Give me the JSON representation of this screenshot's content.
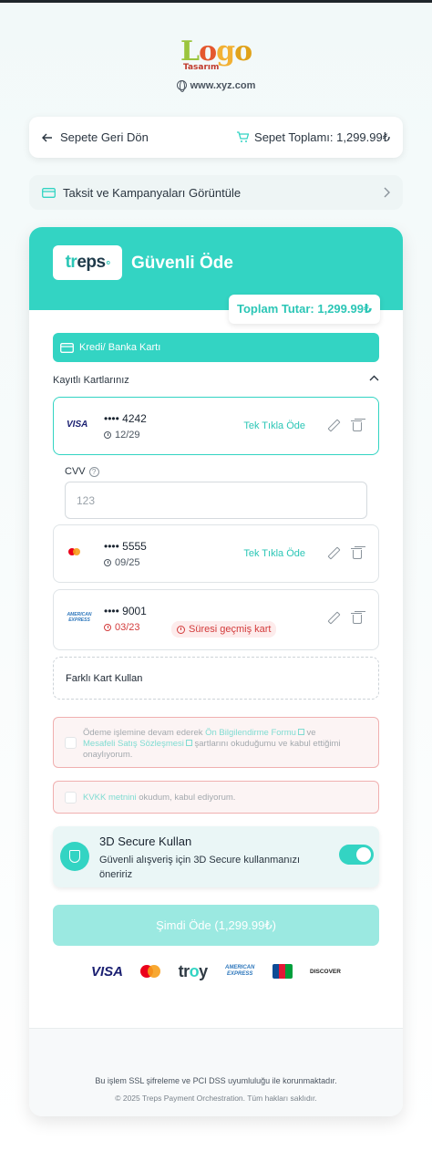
{
  "header": {
    "logo": "Logo Tasarım",
    "site_url": "www.xyz.com"
  },
  "nav": {
    "back_label": "Sepete Geri Dön",
    "cart_total_label": "Sepet Toplamı: 1,299.99₺",
    "installments_label": "Taksit ve Kampanyaları Görüntüle"
  },
  "payment": {
    "provider": "treps",
    "title": "Güvenli Öde",
    "total_label": "Toplam Tutar: 1,299.99₺",
    "method_label": "Kredi/ Banka Kartı",
    "saved_cards_heading": "Kayıtlı Kartlarınız",
    "cards": [
      {
        "brand": "VISA",
        "number": "•••• 4242",
        "expiry": "12/29",
        "action": "Tek Tıkla Öde",
        "selected": true,
        "expired": false
      },
      {
        "brand": "mastercard",
        "number": "•••• 5555",
        "expiry": "09/25",
        "action": "Tek Tıkla Öde",
        "selected": false,
        "expired": false
      },
      {
        "brand": "AMERICAN EXPRESS",
        "number": "•••• 9001",
        "expiry": "03/23",
        "expired_label": "Süresi geçmiş kart",
        "selected": false,
        "expired": true
      }
    ],
    "cvv_label": "CVV",
    "cvv_placeholder": "123",
    "other_card_label": "Farklı Kart Kullan",
    "consent1": {
      "pre": "Ödeme işlemine devam ederek ",
      "link1": "Ön Bilgilendirme Formu",
      "mid": " ve",
      "link2": "Mesafeli Satış Sözleşmesi",
      "post": " şartlarını okuduğumu ve kabul ettiğimi onaylıyorum."
    },
    "consent2": {
      "link": "KVKK metnini",
      "post": " okudum, kabul ediyorum."
    },
    "secure3d": {
      "title": "3D Secure Kullan",
      "description": "Güvenli alışveriş için 3D Secure kullanmanızı öneririz",
      "enabled": true
    },
    "pay_button": "Şimdi Öde (1,299.99₺)",
    "brands": [
      "VISA",
      "mastercard",
      "troy",
      "AMERICAN EXPRESS",
      "JCB",
      "DISCOVER"
    ]
  },
  "footer": {
    "security_note": "Bu işlem SSL şifreleme ve PCI DSS uyumluluğu ile korunmaktadır.",
    "copyright": "© 2025 Treps Payment Orchestration. Tüm hakları saklıdır."
  },
  "colors": {
    "accent": "#33d4c3",
    "accent_light": "#9be9e1",
    "danger": "#d33b3b"
  }
}
